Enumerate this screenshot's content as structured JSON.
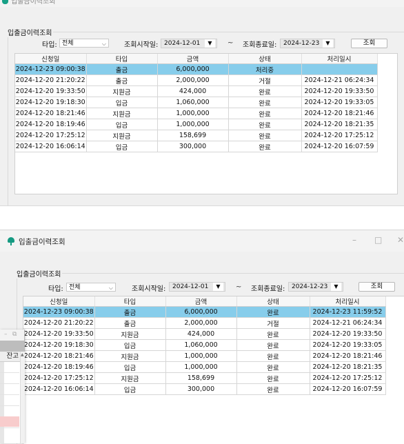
{
  "window_a": {
    "title": "입출금이력조회",
    "group_label": "입출금이력조회",
    "filters": {
      "type_label": "타입:",
      "type_value": "전체",
      "start_label": "조회시작일:",
      "start_date": "2024-12-01",
      "range_sep": "~",
      "end_label": "조회종료일:",
      "end_date": "2024-12-23",
      "search_button": "조회"
    },
    "columns": [
      "신청일",
      "타입",
      "금액",
      "상태",
      "처리일시"
    ],
    "rows": [
      [
        "2024-12-23 09:00:38",
        "출금",
        "6,000,000",
        "처리중",
        ""
      ],
      [
        "2024-12-20 21:20:22",
        "출금",
        "2,000,000",
        "거절",
        "2024-12-21 06:24:34"
      ],
      [
        "2024-12-20 19:33:50",
        "지원금",
        "424,000",
        "완료",
        "2024-12-20 19:33:50"
      ],
      [
        "2024-12-20 19:18:30",
        "입금",
        "1,060,000",
        "완료",
        "2024-12-20 19:33:05"
      ],
      [
        "2024-12-20 18:21:46",
        "지원금",
        "1,000,000",
        "완료",
        "2024-12-20 18:21:46"
      ],
      [
        "2024-12-20 18:19:46",
        "입금",
        "1,000,000",
        "완료",
        "2024-12-20 18:21:35"
      ],
      [
        "2024-12-20 17:25:12",
        "지원금",
        "158,699",
        "완료",
        "2024-12-20 17:25:12"
      ],
      [
        "2024-12-20 16:06:14",
        "입금",
        "300,000",
        "완료",
        "2024-12-20 16:07:59"
      ]
    ]
  },
  "window_b": {
    "title": "입출금이력조회",
    "group_label": "입출금이력조회",
    "filters": {
      "type_label": "타입:",
      "type_value": "전체",
      "start_label": "조회시작일:",
      "start_date": "2024-12-01",
      "range_sep": "~",
      "end_label": "조회종료일:",
      "end_date": "2024-12-23",
      "search_button": "조회"
    },
    "columns": [
      "신청일",
      "타입",
      "금액",
      "상태",
      "처리일시"
    ],
    "rows": [
      [
        "2024-12-23 09:00:38",
        "출금",
        "6,000,000",
        "완료",
        "2024-12-23 11:59:52"
      ],
      [
        "2024-12-20 21:20:22",
        "출금",
        "2,000,000",
        "거절",
        "2024-12-21 06:24:34"
      ],
      [
        "2024-12-20 19:33:50",
        "지원금",
        "424,000",
        "완료",
        "2024-12-20 19:33:50"
      ],
      [
        "2024-12-20 19:18:30",
        "입금",
        "1,060,000",
        "완료",
        "2024-12-20 19:33:05"
      ],
      [
        "2024-12-20 18:21:46",
        "지원금",
        "1,000,000",
        "완료",
        "2024-12-20 18:21:46"
      ],
      [
        "2024-12-20 18:19:46",
        "입금",
        "1,000,000",
        "완료",
        "2024-12-20 18:21:35"
      ],
      [
        "2024-12-20 17:25:12",
        "지원금",
        "158,699",
        "완료",
        "2024-12-20 17:25:12"
      ],
      [
        "2024-12-20 16:06:14",
        "입금",
        "300,000",
        "완료",
        "2024-12-20 16:07:59"
      ]
    ]
  },
  "background_window": {
    "partial_label": "잔고"
  },
  "icons": {
    "app": "jellyfish-app-icon",
    "combo_chevron": "chevron-down-icon",
    "date_dropdown": "triangle-down-icon"
  },
  "colors": {
    "selected_row": "#87cdeb",
    "app_icon": "#159a82",
    "window_bg": "#f0f0f0"
  }
}
